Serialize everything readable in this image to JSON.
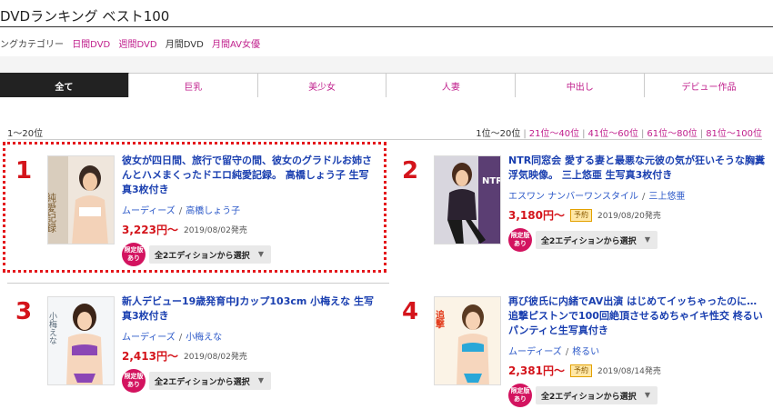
{
  "header": {
    "title": "DVDランキング ベスト100",
    "category_label": "ングカテゴリー",
    "categories": [
      {
        "label": "日間DVD",
        "active": false
      },
      {
        "label": "週間DVD",
        "active": false
      },
      {
        "label": "月間DVD",
        "active": true
      },
      {
        "label": "月間AV女優",
        "active": false
      }
    ]
  },
  "tabs": [
    {
      "label": "全て",
      "active": true
    },
    {
      "label": "巨乳",
      "active": false
    },
    {
      "label": "美少女",
      "active": false
    },
    {
      "label": "人妻",
      "active": false
    },
    {
      "label": "中出し",
      "active": false
    },
    {
      "label": "デビュー作品",
      "active": false
    }
  ],
  "range": {
    "current": "1〜20位",
    "pager": [
      {
        "label": "1位〜20位",
        "current": true
      },
      {
        "label": "21位〜40位",
        "current": false
      },
      {
        "label": "41位〜60位",
        "current": false
      },
      {
        "label": "61位〜80位",
        "current": false
      },
      {
        "label": "81位〜100位",
        "current": false
      }
    ]
  },
  "items": [
    {
      "rank": "1",
      "title": "彼女が四日間、旅行で留守の間、彼女のグラドルお姉さんとハメまくったドエロ純愛記録。 高橋しょう子 生写真3枚付き",
      "maker": "ムーディーズ",
      "actress": "高橋しょう子",
      "price": "3,223円〜",
      "reserve": "",
      "date": "2019/08/02発売",
      "limited": "限定版あり",
      "edition_select": "全2エディションから選択",
      "thumb_text": "純愛記録"
    },
    {
      "rank": "2",
      "title": "NTR同窓会 愛する妻と最悪な元彼の気が狂いそうな胸糞浮気映像。 三上悠亜 生写真3枚付き",
      "maker": "エスワン ナンバーワンスタイル",
      "actress": "三上悠亜",
      "price": "3,180円〜",
      "reserve": "予約",
      "date": "2019/08/20発売",
      "limited": "限定版あり",
      "edition_select": "全2エディションから選択",
      "thumb_text": "NTR同窓会"
    },
    {
      "rank": "3",
      "title": "新人デビュー19歳発育中Jカップ103cm 小梅えな 生写真3枚付き",
      "maker": "ムーディーズ",
      "actress": "小梅えな",
      "price": "2,413円〜",
      "reserve": "",
      "date": "2019/08/02発売",
      "limited": "限定版あり",
      "edition_select": "全2エディションから選択",
      "thumb_text": "小梅えな"
    },
    {
      "rank": "4",
      "title": "再び彼氏に内緒でAV出演 はじめてイッちゃったのに…追撃ピストンで100回絶頂させるめちゃイキ性交 柊るい パンティと生写真付き",
      "maker": "ムーディーズ",
      "actress": "柊るい",
      "price": "2,381円〜",
      "reserve": "予約",
      "date": "2019/08/14発売",
      "limited": "限定版あり",
      "edition_select": "全2エディションから選択",
      "thumb_text": "追撃"
    }
  ]
}
